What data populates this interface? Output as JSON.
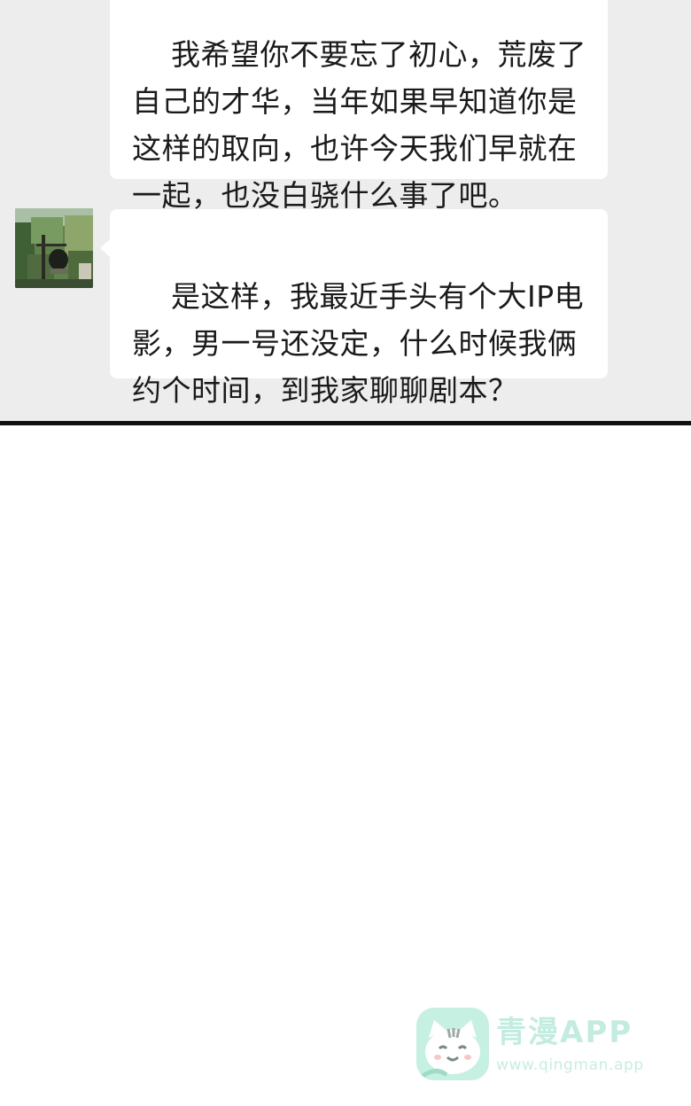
{
  "chat": {
    "messages": [
      {
        "text": "我希望你不要忘了初心，荒废了自己的才华，当年如果早知道你是这样的取向，也许今天我们早就在一起，也没白骁什么事了吧。"
      },
      {
        "text": "是这样，我最近手头有个大IP电影，男一号还没定，什么时候我俩约个时间，到我家聊聊剧本？"
      }
    ],
    "avatar_icon": "avatar-photo"
  },
  "watermark": {
    "title": "青漫APP",
    "url": "www.qingman.app",
    "icon": "cat-face-icon",
    "brand_color": "#c3ece0"
  }
}
